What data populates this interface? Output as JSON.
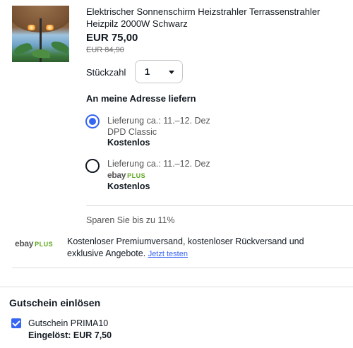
{
  "product": {
    "image_icon": "patio-heater-umbrella-image",
    "title": "Elektrischer Sonnenschirm Heizstrahler Terrassenstrahler Heizpilz 2000W Schwarz",
    "price": "EUR 75,00",
    "old_price": "EUR 84,90"
  },
  "quantity": {
    "label": "Stückzahl",
    "value": "1"
  },
  "shipping": {
    "heading": "An meine Adresse liefern",
    "options": [
      {
        "selected": true,
        "delivery": "Lieferung ca.: 11.–12. Dez",
        "carrier": "DPD Classic",
        "cost": "Kostenlos"
      },
      {
        "selected": false,
        "delivery": "Lieferung ca.: 11.–12. Dez",
        "carrier_logo": [
          "e",
          "b",
          "a",
          "y"
        ],
        "carrier_plus": "PLUS",
        "cost": "Kostenlos"
      }
    ]
  },
  "plus": {
    "savings": "Sparen Sie bis zu 11%",
    "logo_letters": [
      "e",
      "b",
      "a",
      "y"
    ],
    "logo_plus": "PLUS",
    "description": "Kostenloser Premiumversand, kostenloser Rückversand und exklusive Angebote.",
    "link": "Jetzt testen"
  },
  "coupon": {
    "heading": "Gutschein einlösen",
    "checked": true,
    "name": "Gutschein PRIMA10",
    "redeemed": "Eingelöst: EUR 7,50"
  },
  "colors": {
    "accent": "#3665f3",
    "ebay_e": "#e53238",
    "ebay_b": "#0064d2",
    "ebay_a": "#f5af02",
    "ebay_y": "#86b817",
    "plus_green": "#5ba71b"
  }
}
